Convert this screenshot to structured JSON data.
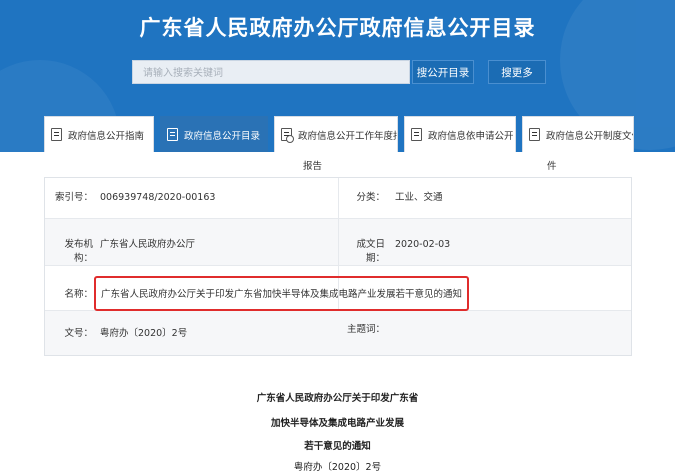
{
  "header": {
    "site_title": "广东省人民政府办公厅政府信息公开目录",
    "search_placeholder": "请输入搜索关键词",
    "search_button": "搜公开目录",
    "search_more_button": "搜更多"
  },
  "tabs": [
    {
      "label": "政府信息公开指南",
      "icon": "document-icon",
      "active": false
    },
    {
      "label": "政府信息公开目录",
      "icon": "list-icon",
      "active": true
    },
    {
      "label": "政府信息公开工作年度报告",
      "icon": "settings-document-icon",
      "active": false
    },
    {
      "label": "政府信息依申请公开",
      "icon": "folder-icon",
      "active": false
    },
    {
      "label": "政府信息公开制度文件",
      "icon": "document-icon",
      "active": false
    }
  ],
  "tab_overflow": {
    "tab3_suffix": "报告",
    "tab5_suffix": "件"
  },
  "info": {
    "index_label": "索引号：",
    "index_value": "006939748/2020-00163",
    "category_label": "分类：",
    "category_value": "工业、交通",
    "publisher_label": "发布机构：",
    "publisher_value": "广东省人民政府办公厅",
    "date_label": "成文日期：",
    "date_value": "2020-02-03",
    "name_label": "名称：",
    "name_value": "广东省人民政府办公厅关于印发广东省加快半导体及集成电路产业发展若干意见的通知",
    "docno_label": "文号：",
    "docno_value": "粤府办〔2020〕2号",
    "topic_label": "主题词："
  },
  "document": {
    "title_line1": "广东省人民政府办公厅关于印发广东省",
    "title_line2": "加快半导体及集成电路产业发展",
    "title_line3": "若干意见的通知",
    "doc_number": "粤府办〔2020〕2号"
  },
  "colors": {
    "header_bg": "#1f74c1",
    "active_tab": "#2a72b5",
    "highlight_border": "#e02c2c"
  }
}
